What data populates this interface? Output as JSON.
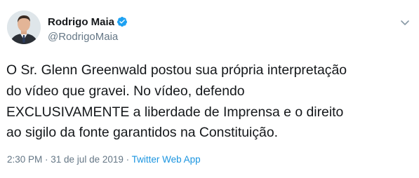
{
  "author": {
    "display_name": "Rodrigo Maia",
    "handle": "@RodrigoMaia",
    "verified": true
  },
  "tweet": {
    "text": "O Sr. Glenn Greenwald postou sua própria interpretação\ndo vídeo que gravei. No vídeo, defendo\nEXCLUSIVAMENTE a liberdade de Imprensa e o direito\nao sigilo da fonte garantidos na Constituição."
  },
  "meta": {
    "timestamp": "2:30 PM · 31 de jul de 2019",
    "separator": " · ",
    "source": "Twitter Web App"
  },
  "colors": {
    "verified_badge": "#1da1f2",
    "link": "#1b95e0",
    "secondary_text": "#657786"
  },
  "icons": {
    "verified": "verified-badge-icon",
    "menu": "chevron-down-icon"
  }
}
